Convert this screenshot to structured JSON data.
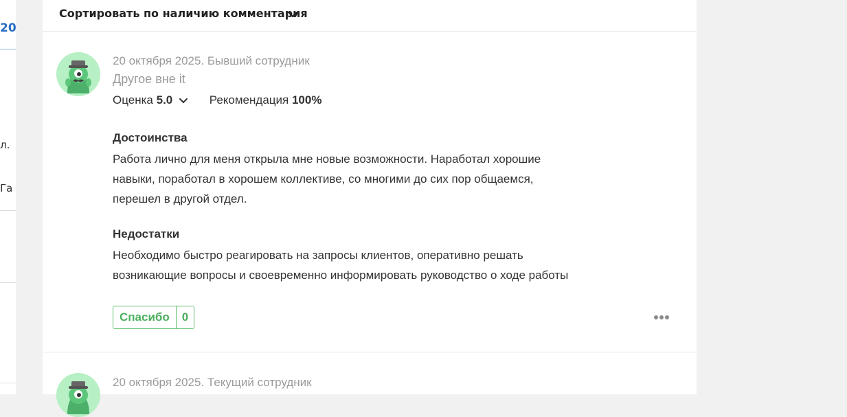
{
  "sidebar_fragments": {
    "number": "20",
    "frag1": "л.",
    "frag2": "Га"
  },
  "sort": {
    "label": "Сортировать по наличию комментария"
  },
  "reviews": [
    {
      "meta": "20 октября 2025. Бывший сотрудник",
      "role": "Другое вне it",
      "rating_label": "Оценка",
      "rating_value": "5.0",
      "recommend_label": "Рекомендация",
      "recommend_value": "100%",
      "pros_title": "Достоинства",
      "pros_text": "Работа лично для меня открыла мне новые возможности. Наработал хорошие навыки, поработал в хорошем коллективе, со многими до сих пор общаемся, перешел в другой отдел.",
      "cons_title": "Недостатки",
      "cons_text": "Необходимо быстро реагировать на запросы клиентов, оперативно решать возникающие вопросы и своевременно информировать руководство о ходе работы",
      "thanks_label": "Спасибо",
      "thanks_count": "0"
    },
    {
      "meta": "20 октября 2025. Текущий сотрудник"
    }
  ],
  "colors": {
    "accent_green": "#4caf5f",
    "link_blue": "#2a6ec6",
    "avatar_bg": "#b7f0c4"
  }
}
